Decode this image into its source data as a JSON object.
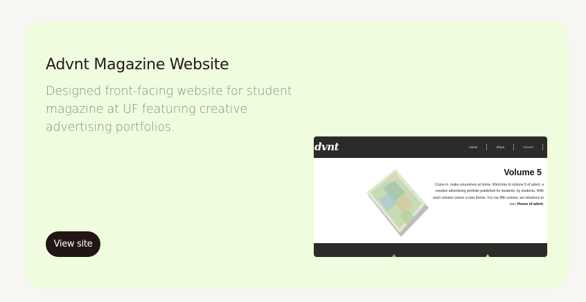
{
  "project": {
    "title": "Advnt Magazine Website",
    "description": "Designed front-facing website for student magazine at UF featuring creative advertising portfolios.",
    "view_button_label": "View site"
  },
  "preview": {
    "logo": "dvnt",
    "nav": [
      "Home",
      "About",
      "Volume"
    ],
    "active_nav": "Volume",
    "volume_title": "Volume 5",
    "volume_text_intro": "Come in, make yourselves at home. Welcome to volume 5 of advnt, a creative advertising portfolio published for students, by students. With each volume comes a new theme. For our fifth volume, we introduce to you: ",
    "volume_text_theme": "House of advnt."
  },
  "colors": {
    "page_background": "#f7f6f2",
    "card_background": "#effcde",
    "button_background": "#221614",
    "preview_nav": "#2d2b2a"
  }
}
